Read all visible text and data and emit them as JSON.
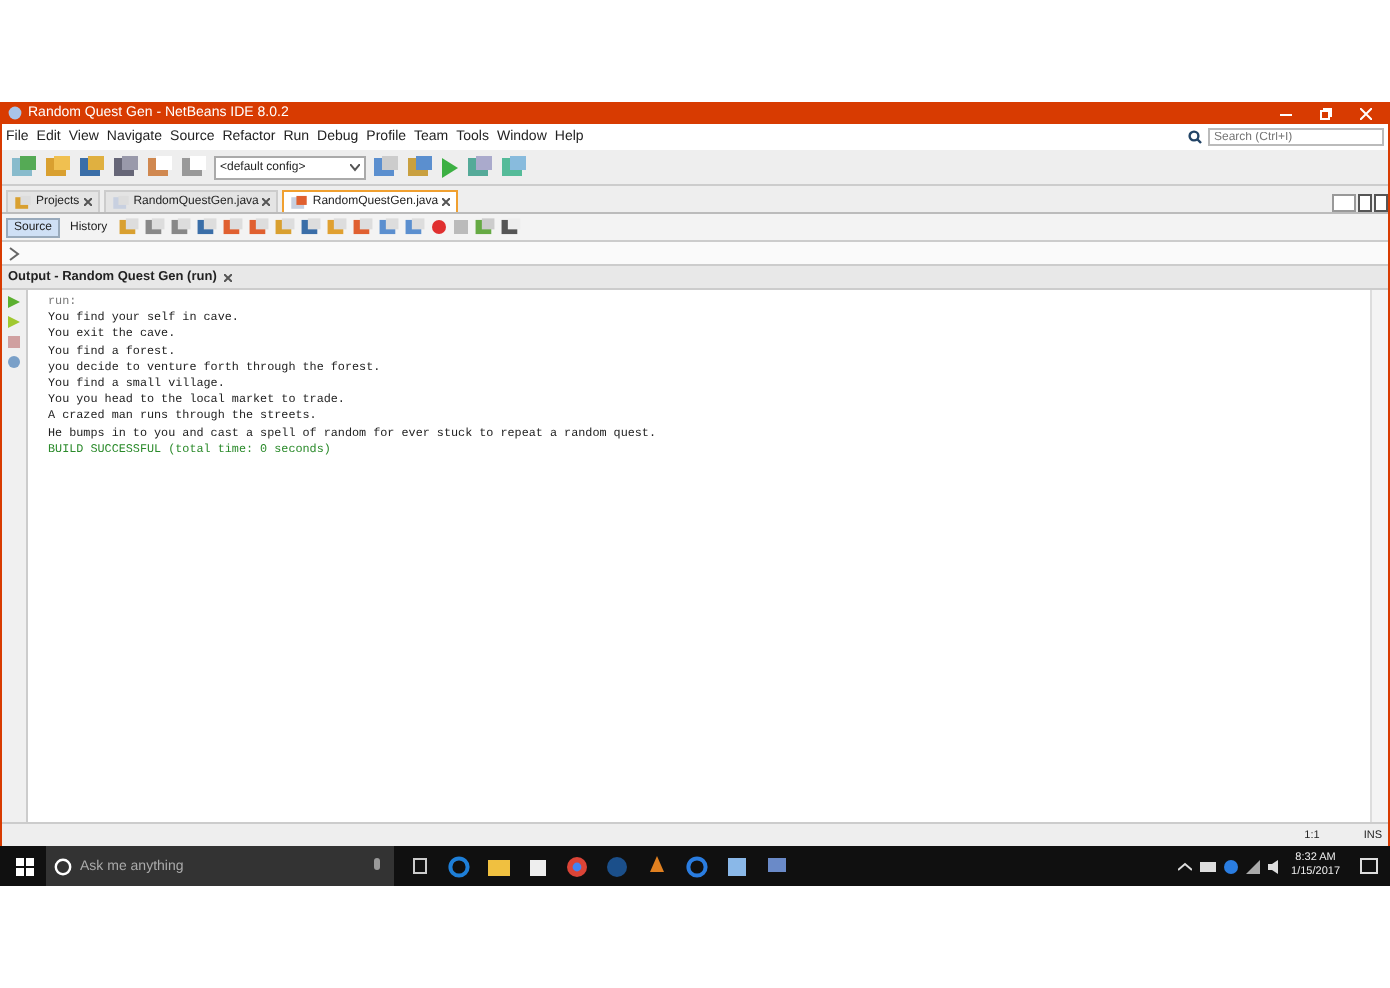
{
  "window": {
    "title": "Random Quest Gen - NetBeans IDE 8.0.2"
  },
  "menu": [
    "File",
    "Edit",
    "View",
    "Navigate",
    "Source",
    "Refactor",
    "Run",
    "Debug",
    "Profile",
    "Team",
    "Tools",
    "Window",
    "Help"
  ],
  "search": {
    "placeholder": "Search (Ctrl+I)"
  },
  "toolbar": {
    "config": "<default config>"
  },
  "tabs": [
    {
      "label": "Projects",
      "selected": false
    },
    {
      "label": "RandomQuestGen.java",
      "selected": false
    },
    {
      "label": "RandomQuestGen.java",
      "selected": true
    }
  ],
  "editor_tabs": [
    {
      "label": "Source",
      "selected": true
    },
    {
      "label": "History",
      "selected": false
    }
  ],
  "output": {
    "title": "Output - Random Quest Gen (run)",
    "lines": [
      {
        "kind": "info",
        "text": "run:"
      },
      {
        "kind": "normal",
        "text": "You find your self in cave."
      },
      {
        "kind": "normal",
        "text": "You exit the cave."
      },
      {
        "kind": "normal",
        "text": "You find a forest."
      },
      {
        "kind": "normal",
        "text": "you decide to venture forth through the forest."
      },
      {
        "kind": "normal",
        "text": "You find a small village."
      },
      {
        "kind": "normal",
        "text": "You you head to the local market to trade."
      },
      {
        "kind": "normal",
        "text": "A crazed man runs through the streets."
      },
      {
        "kind": "normal",
        "text": "He bumps in to you and cast a spell of random for ever stuck to repeat a random quest."
      },
      {
        "kind": "success",
        "text": "BUILD SUCCESSFUL (total time: 0 seconds)"
      }
    ]
  },
  "status_bar": {
    "position": "1:1",
    "mode": "INS"
  },
  "taskbar": {
    "search_placeholder": "Ask me anything",
    "time": "8:32 AM",
    "date": "1/15/2017"
  }
}
